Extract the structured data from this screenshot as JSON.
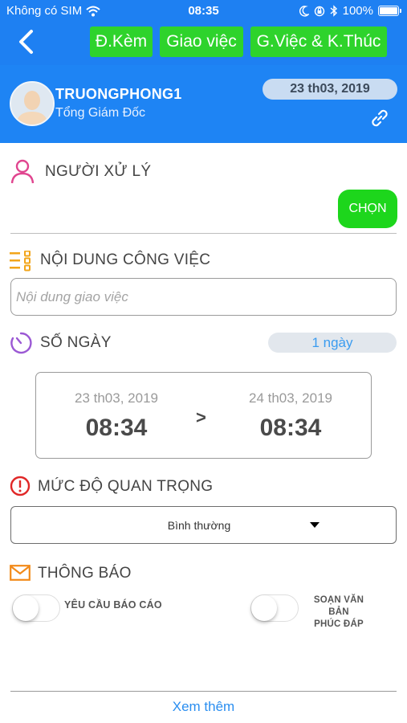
{
  "status_bar": {
    "carrier": "Không có SIM",
    "time": "08:35",
    "battery": "100%"
  },
  "header": {
    "buttons": [
      "Đ.Kèm",
      "Giao việc",
      "G.Việc & K.Thúc"
    ]
  },
  "profile": {
    "name": "TRUONGPHONG1",
    "role": "Tổng Giám Đốc",
    "date": "23 th03, 2019"
  },
  "handler": {
    "title": "NGƯỜI XỬ LÝ",
    "choose_label": "CHỌN"
  },
  "task": {
    "title": "NỘI DUNG CÔNG VIỆC",
    "placeholder": "Nội dung giao việc",
    "value": ""
  },
  "days": {
    "title": "SỐ NGÀY",
    "value": "1 ngày",
    "start_date": "23 th03, 2019",
    "start_time": "08:34",
    "arrow": ">",
    "end_date": "24 th03, 2019",
    "end_time": "08:34"
  },
  "priority": {
    "title": "MỨC ĐỘ QUAN TRỌNG",
    "selected": "Bình thường"
  },
  "notify": {
    "title": "THÔNG BÁO",
    "option1_label": "YÊU CẦU BÁO CÁO",
    "option1_on": false,
    "option2_line1": "SOẠN VĂN BẢN",
    "option2_line2": "PHÚC ĐÁP",
    "option2_on": false
  },
  "footer": {
    "more_label": "Xem thêm"
  },
  "colors": {
    "header_blue": "#1e80f2",
    "action_green": "#2ed32c",
    "link_blue": "#2a8ef0"
  }
}
